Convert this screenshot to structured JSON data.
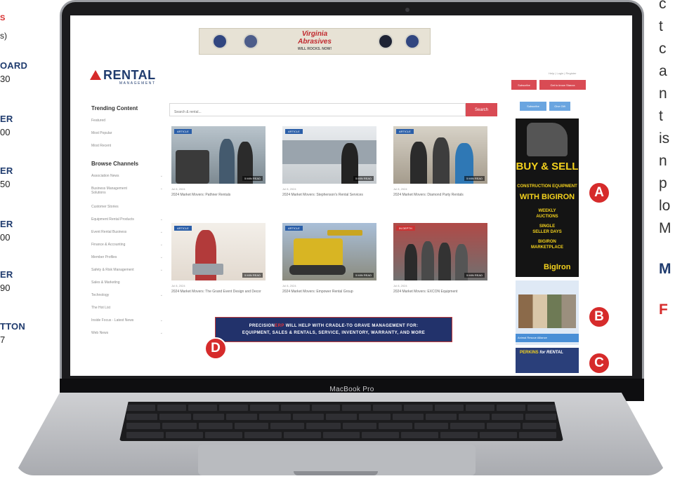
{
  "left_panel": {
    "line1": "S",
    "line2": "s)",
    "items": [
      {
        "title": "OARD",
        "value": "30"
      },
      {
        "title": "ER",
        "value": "00"
      },
      {
        "title": "ER",
        "value": "50"
      },
      {
        "title": "ER",
        "value": "00"
      },
      {
        "title": "ER",
        "value": "90"
      },
      {
        "title": "TTON",
        "value": "7"
      }
    ]
  },
  "right_panel": {
    "lines": [
      "c",
      "t",
      "c",
      "a",
      "n",
      "t",
      "is",
      "n",
      "p",
      "lo",
      "M"
    ],
    "bold1": "M",
    "bold2": "F"
  },
  "device": {
    "chin_label": "MacBook Pro"
  },
  "site": {
    "top_banner": {
      "line1": "Virginia",
      "line2": "Abrasives",
      "sub": "WILL ROCKS. NOW!"
    },
    "logo": {
      "word": "RENTAL",
      "sub": "MANAGEMENT"
    },
    "sidebar": {
      "trending_heading": "Trending Content",
      "trending_items": [
        "Featured",
        "Most Popular",
        "Most Recent"
      ],
      "browse_heading": "Browse Channels",
      "channels": [
        {
          "label": "Association News",
          "chevron": "⌄"
        },
        {
          "label": "Business Management Solutions",
          "chevron": "⌄"
        },
        {
          "label": "Customer Stories",
          "chevron": ""
        },
        {
          "label": "Equipment Rental Products",
          "chevron": "⌄"
        },
        {
          "label": "Event Rental Business",
          "chevron": "⌄"
        },
        {
          "label": "Finance & Accounting",
          "chevron": "⌄"
        },
        {
          "label": "Member Profiles",
          "chevron": "⌄"
        },
        {
          "label": "Safety & Risk Management",
          "chevron": "⌄"
        },
        {
          "label": "Sales & Marketing",
          "chevron": ""
        },
        {
          "label": "Technology",
          "chevron": "⌄"
        },
        {
          "label": "The Hot List",
          "chevron": ""
        },
        {
          "label": "Inside Focus - Latest News",
          "chevron": "⌄"
        },
        {
          "label": "Web News",
          "chevron": "⌄"
        }
      ]
    },
    "search": {
      "placeholder": "Search & rental...",
      "button_label": "Search"
    },
    "cards": [
      {
        "tag": "ARTICLE",
        "read": "5 MIN READ",
        "date": "Jul 8, 2024",
        "title": "2024 Market Movers: Pathner Rentals"
      },
      {
        "tag": "ARTICLE",
        "read": "5 MIN READ",
        "date": "Jul 8, 2024",
        "title": "2024 Market Movers: Stephenson's Rental Services"
      },
      {
        "tag": "ARTICLE",
        "read": "5 MIN READ",
        "date": "Jul 8, 2024",
        "title": "2024 Market Movers: Diamond Party Rentals"
      },
      {
        "tag": "ARTICLE",
        "read": "5 MIN READ",
        "date": "Jul 8, 2024",
        "title": "2024 Market Movers: The Grand Event Design and Decor"
      },
      {
        "tag": "ARTICLE",
        "read": "5 MIN READ",
        "date": "Jul 8, 2024",
        "title": "2024 Market Movers: Empower Rental Group"
      },
      {
        "tag": "IN DEPTH",
        "read": "5 MIN READ",
        "date": "Jul 8, 2024",
        "title": "2024 Market Movers: EXCON Equipment"
      }
    ],
    "bottom_banner": {
      "brand_a": "PRECISION",
      "brand_b": "ERP",
      "line1_rest": " WILL HELP WITH CRADLE-TO GRAVE MANAGEMENT FOR:",
      "line2": "EQUIPMENT, SALES & RENTALS, SERVICE, INVENTORY, WARRANTY, AND MORE"
    },
    "right_rail": {
      "links": "Help | Login | Register",
      "btn_red1": "Subscribe",
      "btn_red2": "Get to know Stanza",
      "btn_blue1": "Subscribe",
      "btn_blue2": "Give Gift"
    },
    "ad_iron": {
      "big": "BUY & SELL",
      "mid": "CONSTRUCTION EQUIPMENT",
      "with": "WITH BIGIRON",
      "l1": "WEEKLY",
      "l2": "AUCTIONS",
      "l3": "SINGLE",
      "l4": "SELLER DAYS",
      "l5": "BIGIRON",
      "l6": "MARKETPLACE",
      "brand": "BigIron"
    },
    "ad_dogs": {
      "line": "Animal Rescue Alliance"
    },
    "ad_perkins": {
      "title_a": "PERKINS",
      "title_b": "for RENTAL"
    }
  },
  "badges": {
    "a": "A",
    "b": "B",
    "c": "C",
    "d": "D"
  },
  "colors": {
    "accent_red": "#d62b2b",
    "navy": "#1f3b6e",
    "search_red": "#d94b54",
    "link_blue": "#6aa5e0"
  }
}
